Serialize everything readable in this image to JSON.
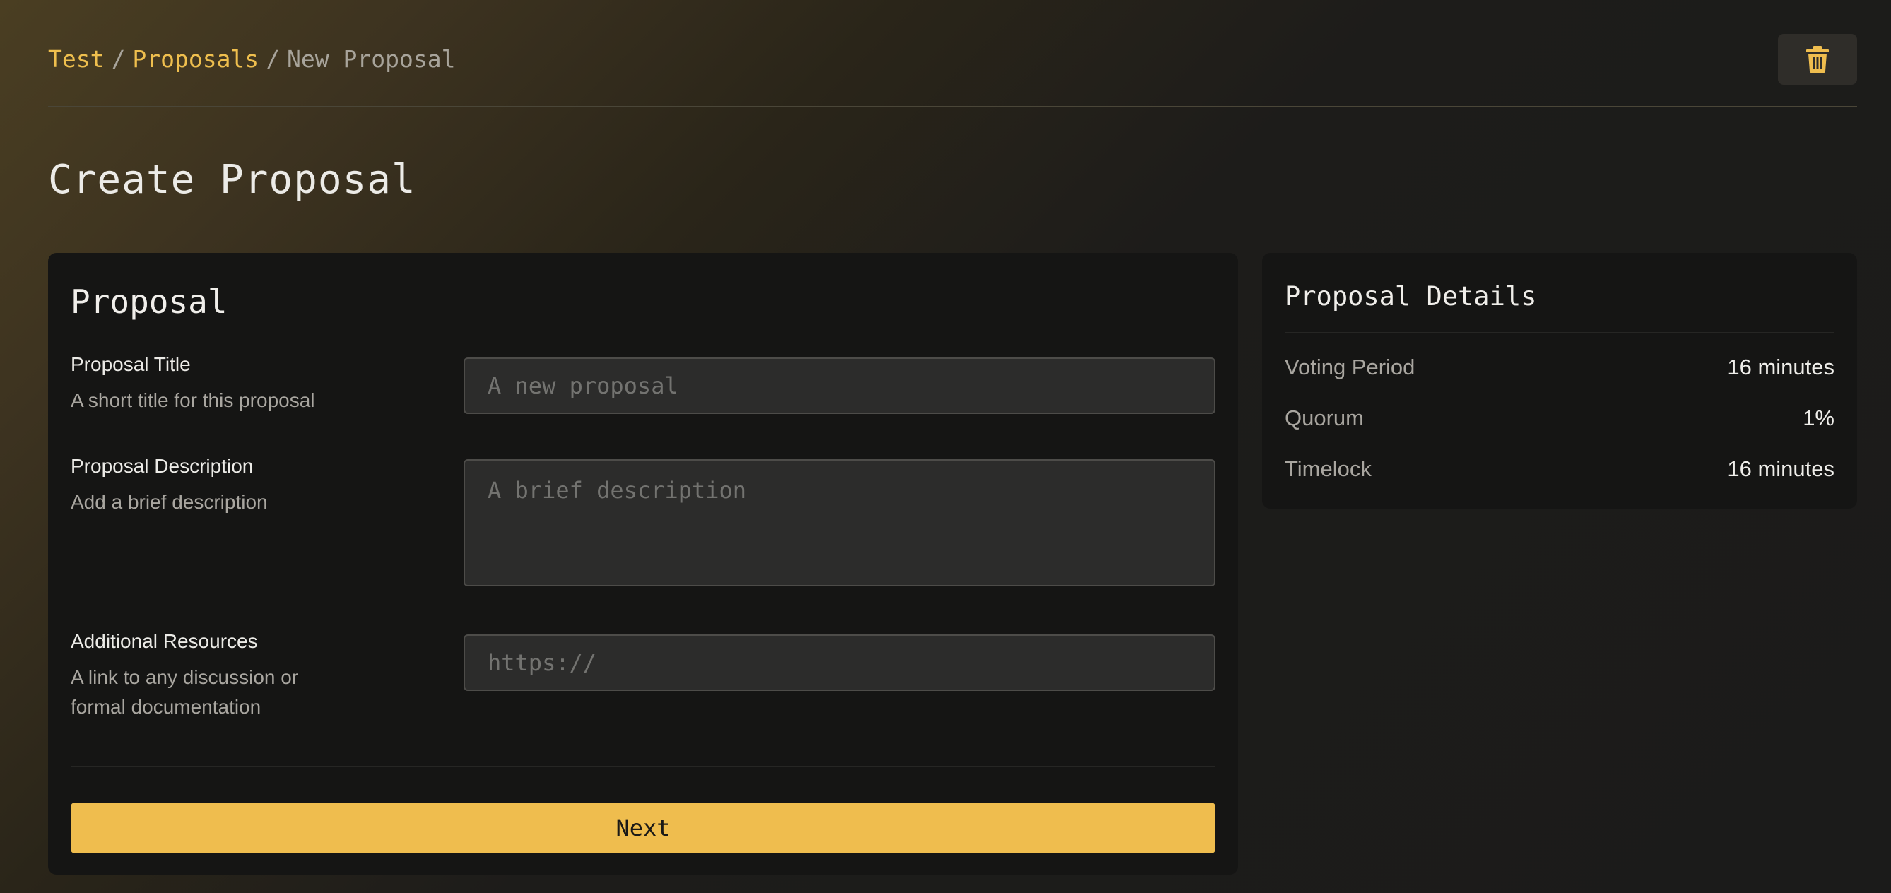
{
  "breadcrumb": {
    "items": [
      {
        "label": "Test"
      },
      {
        "label": "Proposals"
      },
      {
        "label": "New Proposal"
      }
    ],
    "separator": "/"
  },
  "header": {
    "delete_icon": "trash-icon"
  },
  "page": {
    "title": "Create Proposal"
  },
  "form": {
    "title": "Proposal",
    "fields": [
      {
        "label": "Proposal Title",
        "help": "A short title for this proposal",
        "placeholder": "A new proposal",
        "value": ""
      },
      {
        "label": "Proposal Description",
        "help": "Add a brief description",
        "placeholder": "A brief description",
        "value": ""
      },
      {
        "label": "Additional Resources",
        "help": "A link to any discussion or formal documentation",
        "placeholder": "https://",
        "value": ""
      }
    ],
    "next_label": "Next"
  },
  "details": {
    "title": "Proposal Details",
    "rows": [
      {
        "key": "Voting Period",
        "value": "16 minutes"
      },
      {
        "key": "Quorum",
        "value": "1%"
      },
      {
        "key": "Timelock",
        "value": "16 minutes"
      }
    ]
  },
  "colors": {
    "accent": "#efbd4e",
    "background": "#1c1b19",
    "card": "#151514",
    "input": "#2c2c2b"
  }
}
